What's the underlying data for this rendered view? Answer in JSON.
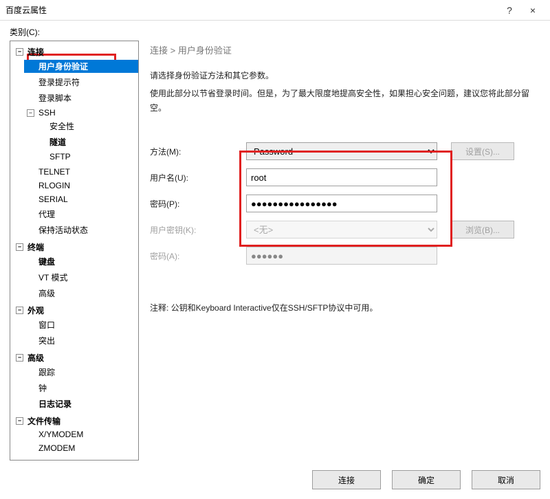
{
  "window": {
    "title": "百度云属性",
    "help": "?",
    "close": "×"
  },
  "category_label": "类别(C):",
  "tree": {
    "connection": "连接",
    "auth": "用户身份验证",
    "login_prompt": "登录提示符",
    "login_script": "登录脚本",
    "ssh": "SSH",
    "security": "安全性",
    "tunnel": "隧道",
    "sftp": "SFTP",
    "telnet": "TELNET",
    "rlogin": "RLOGIN",
    "serial": "SERIAL",
    "proxy": "代理",
    "keepalive": "保持活动状态",
    "terminal": "终端",
    "keyboard": "键盘",
    "vtmode": "VT 模式",
    "advanced1": "高级",
    "appearance": "外观",
    "windowitem": "窗口",
    "highlight": "突出",
    "advanced": "高级",
    "trace": "跟踪",
    "bell": "钟",
    "logging": "日志记录",
    "filetransfer": "文件传输",
    "xymodem": "X/YMODEM",
    "zmodem": "ZMODEM"
  },
  "breadcrumb": "连接  >  用户身份验证",
  "desc1": "请选择身份验证方法和其它参数。",
  "desc2": "使用此部分以节省登录时间。但是，为了最大限度地提高安全性，如果担心安全问题，建议您将此部分留空。",
  "form": {
    "method_label": "方法(M):",
    "method_value": "Password",
    "setup_btn": "设置(S)...",
    "user_label": "用户名(U):",
    "user_value": "root",
    "pass_label": "密码(P):",
    "pass_value": "●●●●●●●●●●●●●●●●",
    "userkey_label": "用户密钥(K):",
    "userkey_value": "<无>",
    "browse_btn": "浏览(B)...",
    "pass2_label": "密码(A):",
    "pass2_value": "●●●●●●"
  },
  "note": "注释: 公钥和Keyboard Interactive仅在SSH/SFTP协议中可用。",
  "footer": {
    "connect": "连接",
    "ok": "确定",
    "cancel": "取消"
  }
}
